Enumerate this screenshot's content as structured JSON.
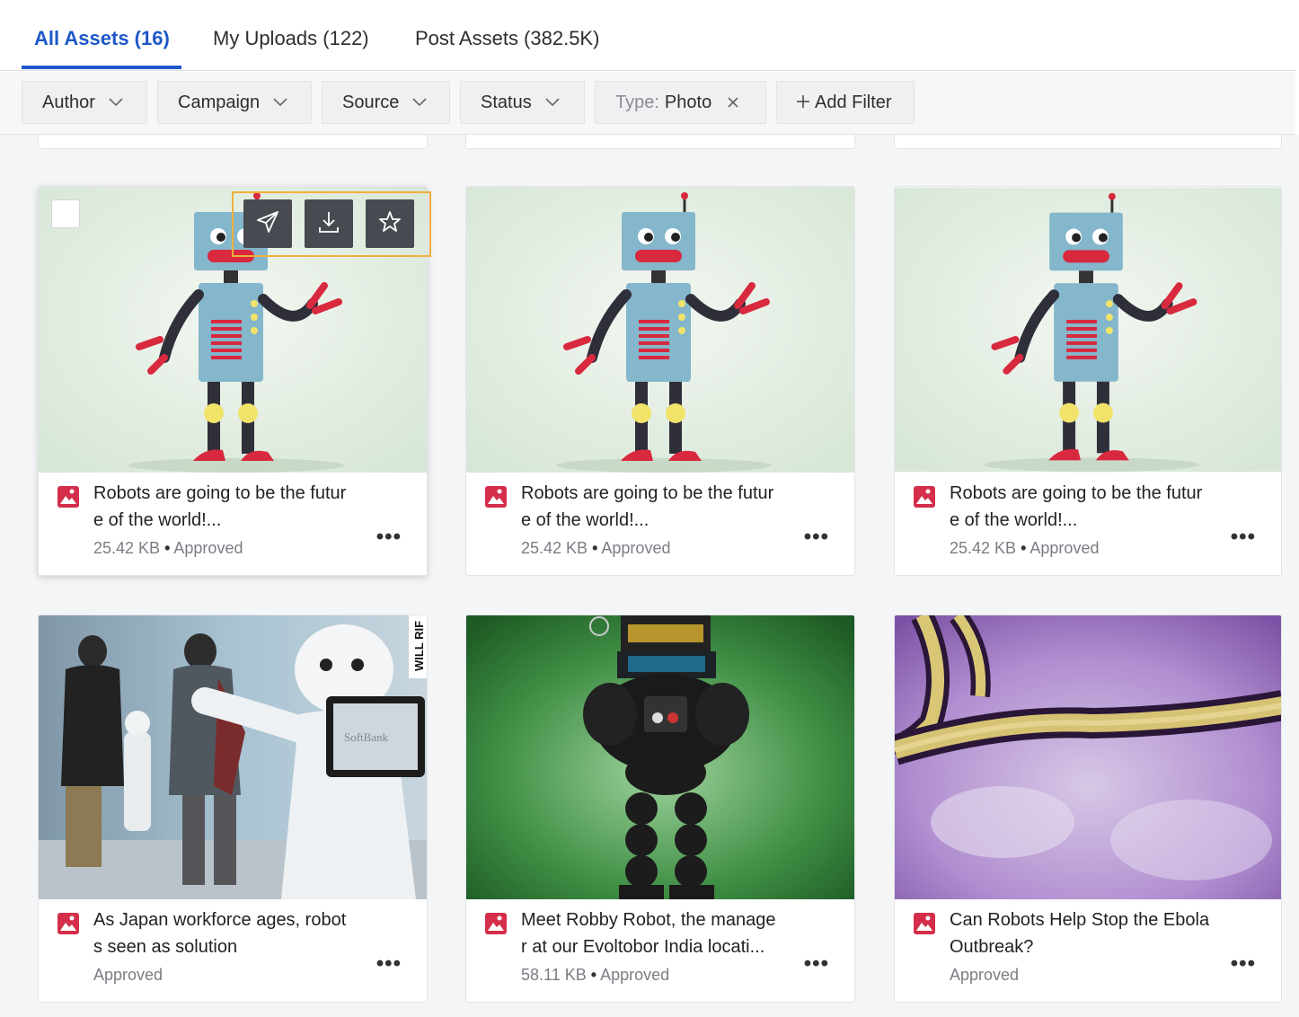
{
  "tabs": [
    {
      "label": "All Assets (16)",
      "active": true
    },
    {
      "label": "My Uploads (122)",
      "active": false
    },
    {
      "label": "Post Assets (382.5K)",
      "active": false
    }
  ],
  "filters": {
    "author": "Author",
    "campaign": "Campaign",
    "source": "Source",
    "status": "Status",
    "type_key": "Type:",
    "type_value": "Photo",
    "add_filter": "Add Filter"
  },
  "cards": [
    {
      "title": "Robots are going to be the future of the world!...",
      "line1": "Robots are going to be the futur",
      "line2": "e of the world!...",
      "meta": "25.42 KB",
      "status": "Approved",
      "image": "cartoon-robot"
    },
    {
      "title": "Robots are going to be the future of the world!...",
      "line1": "Robots are going to be the futur",
      "line2": "e of the world!...",
      "meta": "25.42 KB",
      "status": "Approved",
      "image": "cartoon-robot"
    },
    {
      "title": "Robots are going to be the future of the world!...",
      "line1": "Robots are going to be the futur",
      "line2": "e of the world!...",
      "meta": "25.42 KB",
      "status": "Approved",
      "image": "cartoon-robot"
    },
    {
      "title": "As Japan workforce ages, robots seen as solution",
      "line1": "As Japan workforce ages, robot",
      "line2": "s seen as solution",
      "meta": "",
      "status": "Approved",
      "image": "pepper-robot"
    },
    {
      "title": "Meet Robby Robot, the manager at our Evoltobor India locati...",
      "line1": "Meet Robby Robot, the manage",
      "line2": "r at our Evoltobor India locati...",
      "meta": "58.11 KB",
      "status": "Approved",
      "image": "robby-robot"
    },
    {
      "title": "Can Robots Help Stop the Ebola Outbreak?",
      "line1": "Can Robots Help Stop the Ebola",
      "line2": "Outbreak?",
      "meta": "",
      "status": "Approved",
      "image": "ebola-virus"
    }
  ],
  "photo_text": {
    "watermark": "WILL RIF",
    "tablet": "SoftBank"
  },
  "more_label": "•••",
  "dot_label": "•",
  "colors": {
    "accent": "#1e58c9",
    "highlight": "#f0b03c",
    "file_icon": "#d42e4b"
  }
}
